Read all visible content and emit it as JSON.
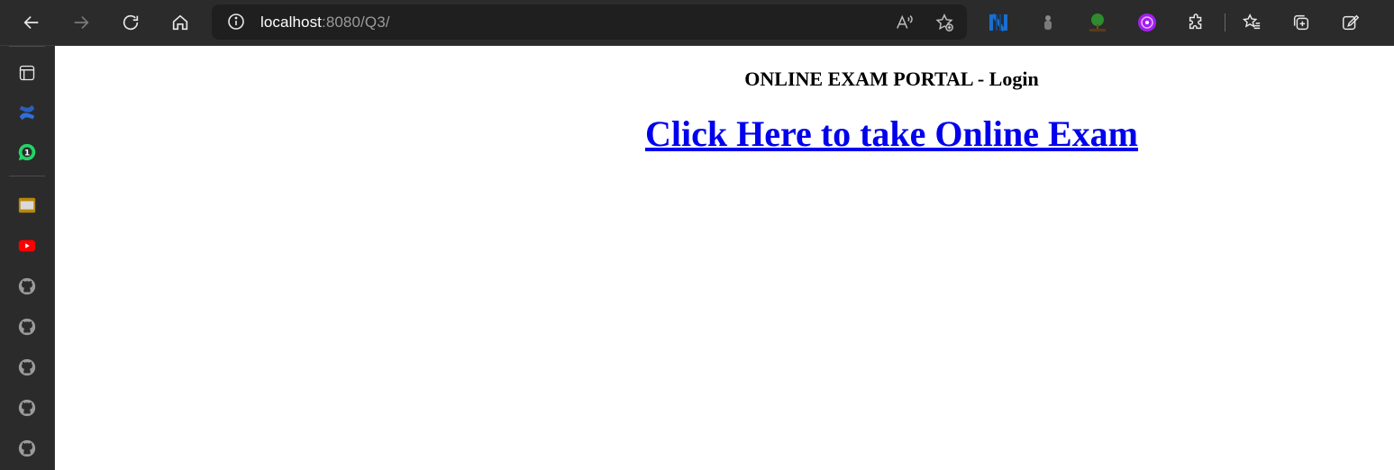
{
  "browser": {
    "url_host": "localhost",
    "url_rest": ":8080/Q3/",
    "nav_icons": [
      "back-arrow-icon",
      "forward-arrow-icon",
      "refresh-icon",
      "home-icon"
    ],
    "extensions": [
      "nordpass-extension-icon",
      "person-extension-icon",
      "tree-extension-icon",
      "purple-extension-icon",
      "extensions-puzzle-icon",
      "favorites-icon",
      "collections-icon",
      "edit-profile-icon"
    ]
  },
  "sidebar": {
    "items": [
      "tab-actions",
      "confluence",
      "whatsapp",
      "folder",
      "youtube",
      "github",
      "github",
      "github",
      "github",
      "github"
    ],
    "whatsapp_badge": "1"
  },
  "page": {
    "heading": "ONLINE EXAM PORTAL - Login",
    "link_text": "Click Here to take Online Exam"
  },
  "colors": {
    "link": "#0000ee",
    "toolbar_bg": "#2b2b2b",
    "address_bg": "#1f1f1f"
  }
}
